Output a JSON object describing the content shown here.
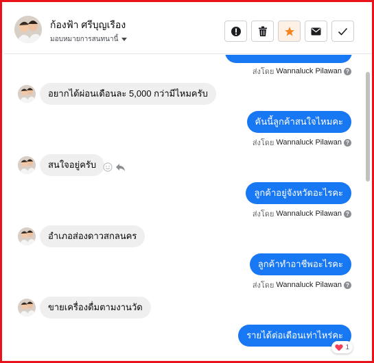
{
  "header": {
    "contact_name": "ก้องฟ้า ศรีบุญเรือง",
    "assign_label": "มอบหมายการสนทนานี้"
  },
  "actions": [
    {
      "name": "mark-spam-button",
      "icon": "alert-circle-icon"
    },
    {
      "name": "delete-button",
      "icon": "trash-icon"
    },
    {
      "name": "star-button",
      "icon": "star-icon",
      "active": true
    },
    {
      "name": "mark-unread-button",
      "icon": "envelope-icon"
    },
    {
      "name": "mark-done-button",
      "icon": "check-icon"
    }
  ],
  "sent_by_prefix": "ส่งโดย",
  "agent_name": "Wannaluck Pilawan",
  "messages": [
    {
      "direction": "in",
      "text": "อยากได้ผ่อนเดือนละ 5,000 กว่ามีไหมครับ"
    },
    {
      "direction": "out",
      "text": "คันนี้ลูกค้าสนใจไหมคะ"
    },
    {
      "direction": "in",
      "text": "สนใจอยู่ครับ"
    },
    {
      "direction": "out",
      "text": "ลูกค้าอยู่จังหวัดอะไรคะ"
    },
    {
      "direction": "in",
      "text": "อำเภอส่องดาวสกลนคร"
    },
    {
      "direction": "out",
      "text": "ลูกค้าทำอาชีพอะไรคะ"
    },
    {
      "direction": "in",
      "text": "ขายเครื่องดื่มตามงานวัด"
    },
    {
      "direction": "out",
      "text": "รายได้ต่อเดือนเท่าไหร่คะ"
    }
  ],
  "last_reaction": {
    "emoji": "heart",
    "count": "1"
  },
  "colors": {
    "frame": "#e8121a",
    "outgoing_bubble": "#1877f2",
    "incoming_bubble": "#efefef",
    "star": "#f5841f"
  }
}
